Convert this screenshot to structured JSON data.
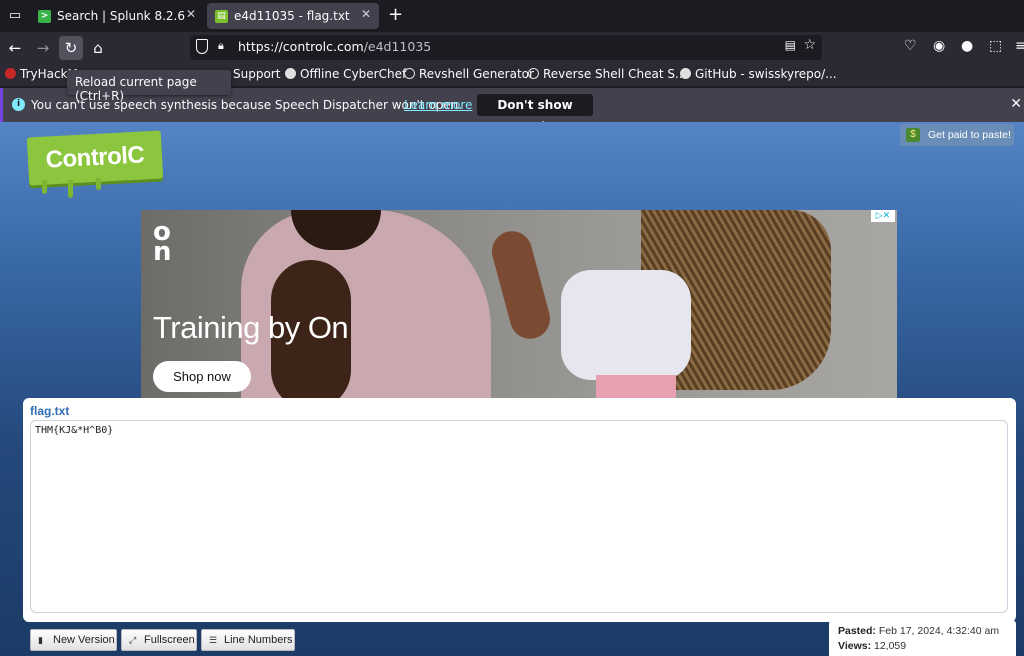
{
  "tabs": [
    {
      "title": "Search | Splunk 8.2.6",
      "favicon": ">"
    },
    {
      "title": "e4d11035 - flag.txt",
      "favicon": "▤"
    }
  ],
  "nav": {
    "url_host": "https://controlc.com",
    "url_path": "/e4d11035",
    "tooltip": "Reload current page (Ctrl+R)"
  },
  "bookmarks": [
    {
      "label": "TryHackM",
      "icon_color": "#c62828"
    },
    {
      "label": "Support",
      "icon_color": ""
    },
    {
      "label": "Offline CyberChef",
      "icon_color": "#e0e0e0"
    },
    {
      "label": "Revshell Generator",
      "icon_color": "#e0e0e0"
    },
    {
      "label": "Reverse Shell Cheat S...",
      "icon_color": "#e0e0e0"
    },
    {
      "label": "GitHub - swisskyrepo/...",
      "icon_color": "#e0e0e0"
    }
  ],
  "notification": {
    "message": "You can't use speech synthesis because Speech Dispatcher won't open.",
    "link": "Learn more",
    "button": "Don't show again"
  },
  "site": {
    "logo": "ControlC",
    "get_paid": "Get paid to paste!"
  },
  "ad": {
    "brand": "On",
    "headline": "Training by On",
    "cta": "Shop now",
    "adchoices": "▷✕"
  },
  "paste": {
    "filename": "flag.txt",
    "content": "THM{KJ&*H^B0}"
  },
  "buttons": {
    "new_version": "New Version",
    "fullscreen": "Fullscreen",
    "line_numbers": "Line Numbers"
  },
  "meta": {
    "pasted_label": "Pasted:",
    "pasted_value": "Feb 17, 2024, 4:32:40 am",
    "views_label": "Views:",
    "views_value": "12,059"
  },
  "colors": {
    "accent_link": "#80ebff",
    "logo_green": "#8cc63f",
    "page_blue": "#2f6db5"
  }
}
